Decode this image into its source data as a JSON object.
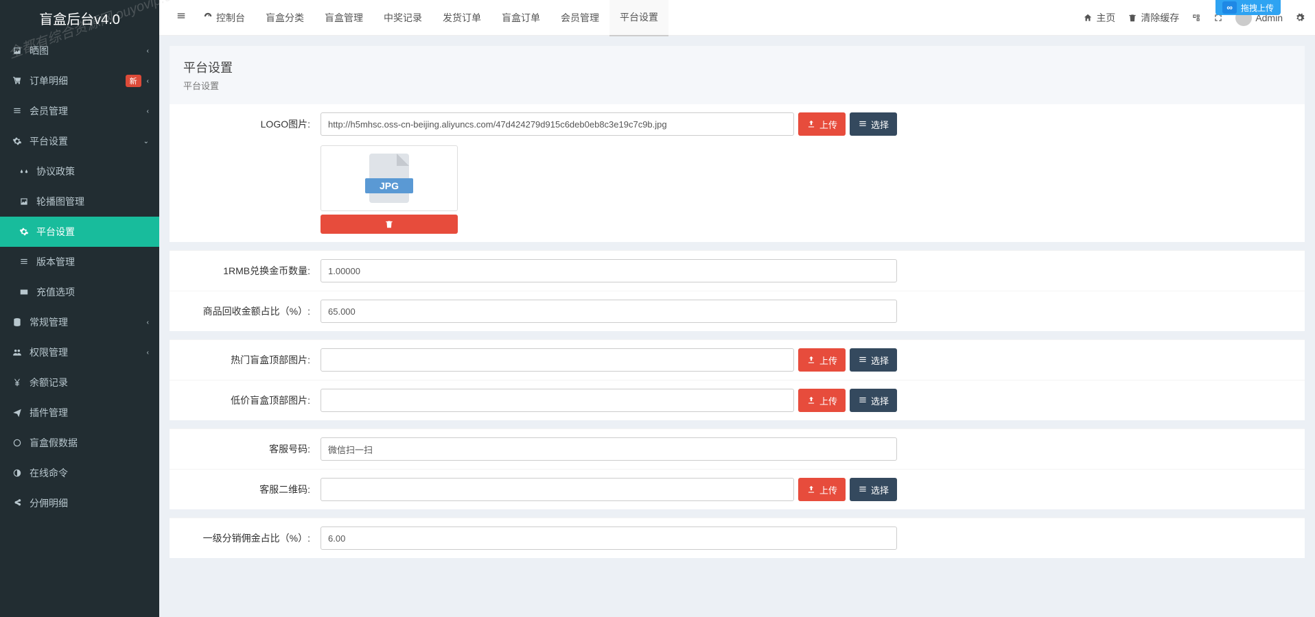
{
  "brand": "盲盒后台v4.0",
  "watermark": "全都有综合资源网\nouyovip.com",
  "sidebar": {
    "items": [
      {
        "icon": "image-icon",
        "label": "晒图",
        "arrow": "‹"
      },
      {
        "icon": "cart-icon",
        "label": "订单明细",
        "badge": "新",
        "arrow": "‹"
      },
      {
        "icon": "list-icon",
        "label": "会员管理",
        "arrow": "‹"
      },
      {
        "icon": "gear-icon",
        "label": "平台设置",
        "arrow": "⌄",
        "expanded": true
      },
      {
        "icon": "balance-icon",
        "label": "协议政策",
        "sub": true
      },
      {
        "icon": "image-icon",
        "label": "轮播图管理",
        "sub": true
      },
      {
        "icon": "gear-icon",
        "label": "平台设置",
        "sub": true,
        "active": true
      },
      {
        "icon": "list-icon",
        "label": "版本管理",
        "sub": true
      },
      {
        "icon": "card-icon",
        "label": "充值选项",
        "sub": true
      },
      {
        "icon": "database-icon",
        "label": "常规管理",
        "arrow": "‹"
      },
      {
        "icon": "users-icon",
        "label": "权限管理",
        "arrow": "‹"
      },
      {
        "icon": "yen-icon",
        "label": "余额记录"
      },
      {
        "icon": "plane-icon",
        "label": "插件管理"
      },
      {
        "icon": "circle-icon",
        "label": "盲盒假数据"
      },
      {
        "icon": "contrast-icon",
        "label": "在线命令"
      },
      {
        "icon": "share-icon",
        "label": "分佣明细"
      }
    ]
  },
  "topnav": {
    "tabs": [
      {
        "icon": "dashboard-icon",
        "label": "控制台"
      },
      {
        "label": "盲盒分类"
      },
      {
        "label": "盲盒管理"
      },
      {
        "label": "中奖记录"
      },
      {
        "label": "发货订单"
      },
      {
        "label": "盲盒订单"
      },
      {
        "label": "会员管理"
      },
      {
        "label": "平台设置",
        "active": true
      }
    ],
    "right": {
      "home": "主页",
      "clear_cache": "清除缓存",
      "username": "Admin"
    }
  },
  "float_badge": {
    "icon": "∞",
    "label": "拖拽上传"
  },
  "panel": {
    "title": "平台设置",
    "subtitle": "平台设置"
  },
  "form": {
    "logo": {
      "label": "LOGO图片:",
      "value": "http://h5mhsc.oss-cn-beijing.aliyuncs.com/47d424279d915c6deb0eb8c3e19c7c9b.jpg",
      "upload": "上传",
      "select": "选择",
      "preview_tag": "JPG"
    },
    "exchange": {
      "label": "1RMB兑换金币数量:",
      "value": "1.00000"
    },
    "recycle": {
      "label": "商品回收金额占比（%）:",
      "value": "65.000"
    },
    "hot_img": {
      "label": "热门盲盒顶部图片:",
      "value": "",
      "upload": "上传",
      "select": "选择"
    },
    "low_img": {
      "label": "低价盲盒顶部图片:",
      "value": "",
      "upload": "上传",
      "select": "选择"
    },
    "service_no": {
      "label": "客服号码:",
      "value": "微信扫一扫"
    },
    "service_qr": {
      "label": "客服二维码:",
      "value": "",
      "upload": "上传",
      "select": "选择"
    },
    "commission": {
      "label": "一级分销佣金占比（%）:",
      "value": "6.00"
    }
  }
}
